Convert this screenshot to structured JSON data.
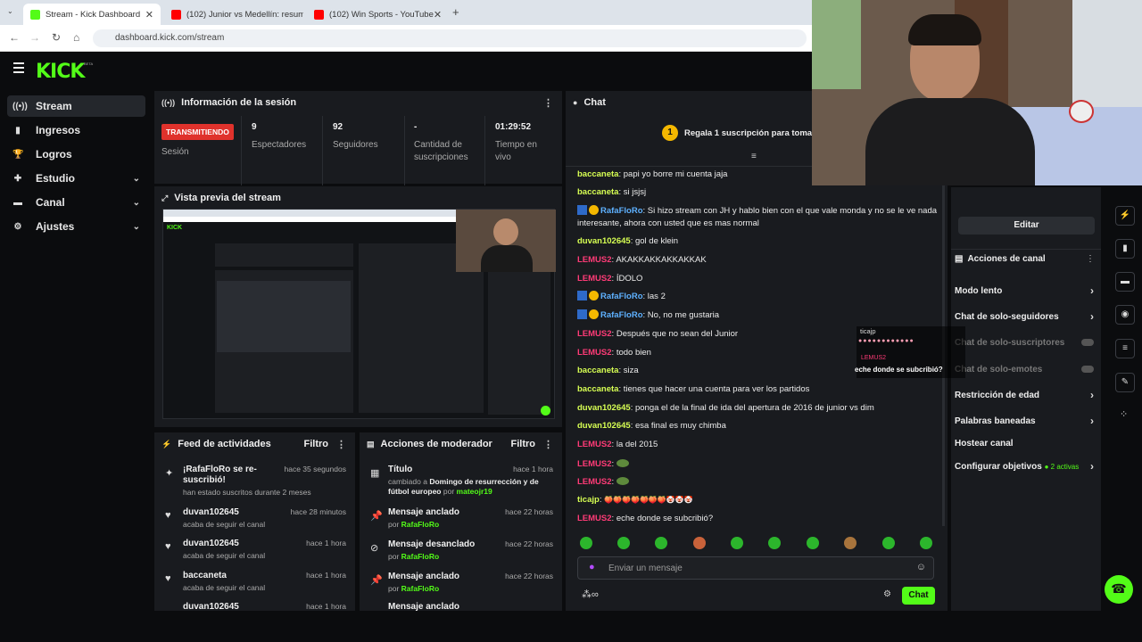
{
  "browser": {
    "tabs": [
      {
        "title": "Stream - Kick Dashboard"
      },
      {
        "title": "(102) Junior vs Medellín: resum"
      },
      {
        "title": "(102) Win Sports - YouTube"
      }
    ],
    "url": "dashboard.kick.com/stream"
  },
  "header": {
    "logo": "KICK",
    "beta": "BETA"
  },
  "sidebar": {
    "items": [
      {
        "label": "Stream",
        "icon": "broadcast-icon"
      },
      {
        "label": "Ingresos",
        "icon": "chart-icon"
      },
      {
        "label": "Logros",
        "icon": "trophy-icon"
      },
      {
        "label": "Estudio",
        "icon": "studio-icon"
      },
      {
        "label": "Canal",
        "icon": "channel-icon"
      },
      {
        "label": "Ajustes",
        "icon": "gear-icon"
      }
    ]
  },
  "session": {
    "title": "Información de la sesión",
    "status": "TRANSMITIENDO",
    "status_label": "Sesión",
    "stats": [
      {
        "value": "9",
        "label": "Espectadores"
      },
      {
        "value": "92",
        "label": "Seguidores"
      },
      {
        "value": "-",
        "label": "Cantidad de suscripciones"
      },
      {
        "value": "01:29:52",
        "label": "Tiempo en vivo"
      }
    ]
  },
  "preview": {
    "title": "Vista previa del stream"
  },
  "feed": {
    "title": "Feed de actividades",
    "filter": "Filtro",
    "items": [
      {
        "name": "¡RafaFloRo se re-suscribió!",
        "sub": "han estado suscritos durante 2 meses",
        "time": "hace 35 segundos"
      },
      {
        "name": "duvan102645",
        "sub": "acaba de seguir el canal",
        "time": "hace 28 minutos"
      },
      {
        "name": "duvan102645",
        "sub": "acaba de seguir el canal",
        "time": "hace 1 hora"
      },
      {
        "name": "baccaneta",
        "sub": "acaba de seguir el canal",
        "time": "hace 1 hora"
      },
      {
        "name": "duvan102645",
        "sub": "",
        "time": "hace 1 hora"
      }
    ]
  },
  "modactions": {
    "title": "Acciones de moderador",
    "filter": "Filtro",
    "items": [
      {
        "name": "Título",
        "pre": "cambiado a",
        "detail": "Domingo de resurrección y de fútbol europeo",
        "by_label": "por",
        "by": "mateojr19",
        "time": "hace 1 hora"
      },
      {
        "name": "Mensaje anclado",
        "pre": "",
        "detail": "",
        "by_label": "por",
        "by": "RafaFloRo",
        "time": "hace 22 horas"
      },
      {
        "name": "Mensaje desanclado",
        "pre": "",
        "detail": "",
        "by_label": "por",
        "by": "RafaFloRo",
        "time": "hace 22 horas"
      },
      {
        "name": "Mensaje anclado",
        "pre": "",
        "detail": "",
        "by_label": "por",
        "by": "RafaFloRo",
        "time": "hace 22 horas"
      },
      {
        "name": "Mensaje anclado",
        "pre": "",
        "detail": "",
        "by_label": "",
        "by": "",
        "time": ""
      }
    ]
  },
  "chat": {
    "title": "Chat",
    "pinned": "Regala 1 suscripción para tomar la",
    "pinned_num": "1",
    "messages": [
      {
        "user": "baccaneta",
        "color": "#d7ff53",
        "text": "papi yo borre mi cuenta jaja"
      },
      {
        "user": "baccaneta",
        "color": "#d7ff53",
        "text": "si jsjsj"
      },
      {
        "user": "RafaFloRo",
        "color": "#5eb1ff",
        "text": "Si hizo stream con JH y hablo bien con el que vale monda y no se le ve nada interesante, ahora con usted que es mas normal"
      },
      {
        "user": "duvan102645",
        "color": "#d7ff53",
        "text": "gol de klein"
      },
      {
        "user": "LEMUS2",
        "color": "#ff3b77",
        "text": "AKAKKAKKAKKAKKAK"
      },
      {
        "user": "LEMUS2",
        "color": "#ff3b77",
        "text": "ÍDOLO"
      },
      {
        "user": "RafaFloRo",
        "color": "#5eb1ff",
        "text": "las 2"
      },
      {
        "user": "RafaFloRo",
        "color": "#5eb1ff",
        "text": "No, no me gustaria"
      },
      {
        "user": "LEMUS2",
        "color": "#ff3b77",
        "text": "Después que no sean del Junior"
      },
      {
        "user": "LEMUS2",
        "color": "#ff3b77",
        "text": "todo bien"
      },
      {
        "user": "baccaneta",
        "color": "#d7ff53",
        "text": "siza"
      },
      {
        "user": "baccaneta",
        "color": "#d7ff53",
        "text": "tienes que hacer una cuenta para ver los partidos"
      },
      {
        "user": "duvan102645",
        "color": "#d7ff53",
        "text": "ponga el de la final de ida del apertura de 2016 de junior vs dim"
      },
      {
        "user": "duvan102645",
        "color": "#d7ff53",
        "text": "esa final es muy chimba"
      },
      {
        "user": "LEMUS2",
        "color": "#ff3b77",
        "text": "la del 2015"
      },
      {
        "user": "LEMUS2",
        "color": "#ff3b77",
        "text": ""
      },
      {
        "user": "LEMUS2",
        "color": "#ff3b77",
        "text": ""
      },
      {
        "user": "ticajp",
        "color": "#d7ff53",
        "text": "🍑🍑🍑🍑🍑🍑🍑🤡🤡🤡"
      },
      {
        "user": "LEMUS2",
        "color": "#ff3b77",
        "text": "eche donde se subcribió?"
      }
    ],
    "input_placeholder": "Enviar un mensaje",
    "send_label": "Chat"
  },
  "channel": {
    "edit_label": "Editar",
    "title": "Acciones de canal",
    "items": [
      {
        "label": "Modo lento",
        "dim": false,
        "type": "chevron"
      },
      {
        "label": "Chat de solo-seguidores",
        "dim": false,
        "type": "chevron"
      },
      {
        "label": "Chat de solo-suscriptores",
        "dim": true,
        "type": "toggle"
      },
      {
        "label": "Chat de solo-emotes",
        "dim": true,
        "type": "toggle"
      },
      {
        "label": "Restricción de edad",
        "dim": false,
        "type": "chevron"
      },
      {
        "label": "Palabras baneadas",
        "dim": false,
        "type": "chevron"
      },
      {
        "label": "Hostear canal",
        "dim": false,
        "type": "none"
      },
      {
        "label": "Configurar objetivos",
        "dim": false,
        "type": "chevron"
      }
    ],
    "goals_active": "2 activas"
  },
  "popup": {
    "user": "ticajp",
    "user2": "LEMUS2",
    "text": "eche donde se subcribió?"
  }
}
